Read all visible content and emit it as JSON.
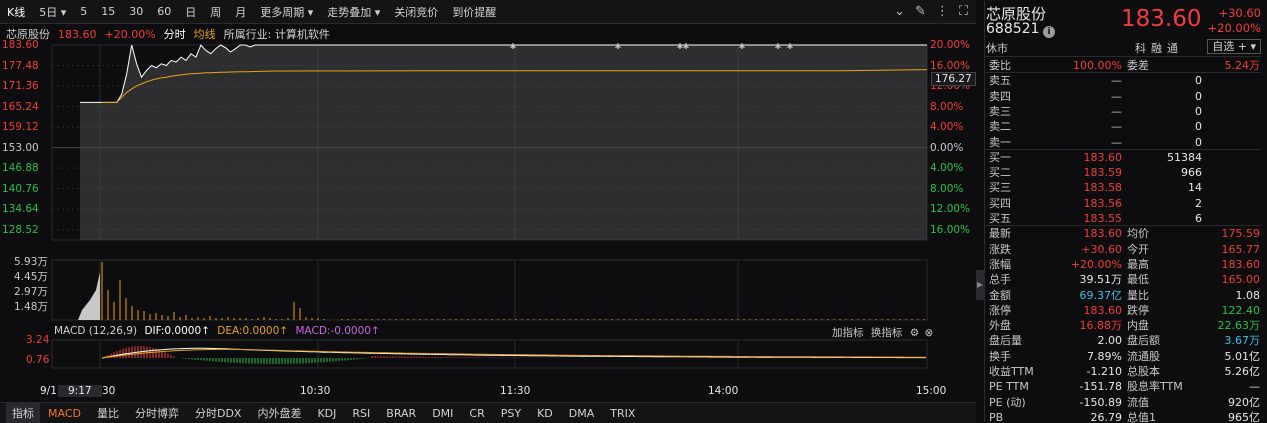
{
  "toolbar": {
    "items": [
      "K线",
      "5日",
      "5",
      "15",
      "30",
      "60",
      "日",
      "周",
      "月",
      "更多周期",
      "走势叠加",
      "关闭竞价",
      "到价提醒"
    ]
  },
  "chart_info": {
    "name": "芯原股份",
    "price": "183.60",
    "pct": "+20.00%",
    "fenshi": "分时",
    "junxian": "均线",
    "industry": "所属行业: 计算机软件"
  },
  "chart_data": {
    "type": "line",
    "price_ticks": [
      "183.60",
      "177.48",
      "171.36",
      "165.24",
      "159.12",
      "153.00",
      "146.88",
      "140.76",
      "134.64",
      "128.52"
    ],
    "pct_ticks": [
      "20.00%",
      "16.00%",
      "12.00%",
      "8.00%",
      "4.00%",
      "0.00%",
      "4.00%",
      "8.00%",
      "12.00%",
      "16.00%"
    ],
    "avg_label": "176.27",
    "vol_ticks": [
      "5.93万",
      "4.45万",
      "2.97万",
      "1.48万"
    ],
    "macd_ticks": [
      "3.24",
      "0.76"
    ],
    "macd_info": {
      "name": "MACD (12,26,9)",
      "dif": "DIF:0.0000",
      "dea": "DEA:0.0000",
      "macd": "MACD:-0.0000"
    },
    "macd_tools": [
      "加指标",
      "换指标"
    ],
    "time_labels": [
      "9/1",
      "9:17",
      "30",
      "10:30",
      "11:30",
      "14:00",
      "15:00"
    ],
    "ylim": [
      128.52,
      183.6
    ],
    "prev_close": 153.0,
    "price_series": [
      166.5,
      166.5,
      166.5,
      166.5,
      169,
      175,
      183.6,
      178,
      174,
      176,
      177.5,
      176.8,
      178,
      177.5,
      179,
      178.5,
      180,
      179,
      181,
      180,
      183.6,
      182,
      181,
      182.5,
      183.6,
      182.8,
      181.5,
      182.5,
      183.6,
      183.6,
      183,
      183.6,
      183.6,
      183.6,
      183.6,
      183.6
    ],
    "avg_series": [
      166.5,
      166.5,
      166.5,
      166.5,
      168,
      169.5,
      170.5,
      171.4,
      172,
      172.6,
      173.1,
      173.5,
      173.8,
      174,
      174.3,
      174.5,
      174.7,
      174.9,
      175.0,
      175.1,
      175.2,
      175.3,
      175.35,
      175.4,
      175.45,
      175.5,
      175.55,
      175.58,
      175.6,
      175.62,
      175.66,
      175.7,
      175.74,
      175.78,
      175.82,
      175.85
    ]
  },
  "panel": {
    "name": "芯原股份",
    "code": "688521",
    "price": "183.60",
    "change": "+30.60",
    "change_pct": "+20.00%",
    "status": "休市",
    "tags": [
      "科",
      "融",
      "通"
    ],
    "fav": "自选 +",
    "weibi": {
      "l1": "委比",
      "v1": "100.00%",
      "l2": "委差",
      "v2": "5.24万"
    },
    "sells": [
      {
        "label": "卖五",
        "price": "—",
        "vol": "0"
      },
      {
        "label": "卖四",
        "price": "—",
        "vol": "0"
      },
      {
        "label": "卖三",
        "price": "—",
        "vol": "0"
      },
      {
        "label": "卖二",
        "price": "—",
        "vol": "0"
      },
      {
        "label": "卖一",
        "price": "—",
        "vol": "0"
      }
    ],
    "buys": [
      {
        "label": "买一",
        "price": "183.60",
        "vol": "51384"
      },
      {
        "label": "买二",
        "price": "183.59",
        "vol": "966"
      },
      {
        "label": "买三",
        "price": "183.58",
        "vol": "14"
      },
      {
        "label": "买四",
        "price": "183.56",
        "vol": "2"
      },
      {
        "label": "买五",
        "price": "183.55",
        "vol": "6"
      }
    ],
    "stats": [
      {
        "l1": "最新",
        "v1": "183.60",
        "c1": "red",
        "l2": "均价",
        "v2": "175.59",
        "c2": "red"
      },
      {
        "l1": "涨跌",
        "v1": "+30.60",
        "c1": "red",
        "l2": "今开",
        "v2": "165.77",
        "c2": "red"
      },
      {
        "l1": "涨幅",
        "v1": "+20.00%",
        "c1": "red",
        "l2": "最高",
        "v2": "183.60",
        "c2": "red"
      },
      {
        "l1": "总手",
        "v1": "39.51万",
        "c1": "white",
        "l2": "最低",
        "v2": "165.00",
        "c2": "red"
      },
      {
        "l1": "金额",
        "v1": "69.37亿",
        "c1": "cyan",
        "l2": "量比",
        "v2": "1.08",
        "c2": "white"
      },
      {
        "l1": "涨停",
        "v1": "183.60",
        "c1": "red",
        "l2": "跌停",
        "v2": "122.40",
        "c2": "green"
      },
      {
        "l1": "外盘",
        "v1": "16.88万",
        "c1": "red",
        "l2": "内盘",
        "v2": "22.63万",
        "c2": "green"
      },
      {
        "l1": "盘后量",
        "v1": "2.00",
        "c1": "white",
        "l2": "盘后额",
        "v2": "3.67万",
        "c2": "cyan"
      },
      {
        "l1": "换手",
        "v1": "7.89%",
        "c1": "white",
        "l2": "流通股",
        "v2": "5.01亿",
        "c2": "white"
      },
      {
        "l1": "收益TTM",
        "v1": "-1.210",
        "c1": "white",
        "l2": "总股本",
        "v2": "5.26亿",
        "c2": "white"
      },
      {
        "l1": "PE TTM",
        "v1": "-151.78",
        "c1": "white",
        "l2": "股息率TTM",
        "v2": "—",
        "c2": "white"
      },
      {
        "l1": "PE (动)",
        "v1": "-150.89",
        "c1": "white",
        "l2": "流值",
        "v2": "920亿",
        "c2": "white"
      },
      {
        "l1": "PB",
        "v1": "26.79",
        "c1": "white",
        "l2": "总值1",
        "v2": "965亿",
        "c2": "white"
      }
    ]
  },
  "tabs": [
    "指标",
    "MACD",
    "量比",
    "分时博弈",
    "分时DDX",
    "内外盘差",
    "KDJ",
    "RSI",
    "BRAR",
    "DMI",
    "CR",
    "PSY",
    "KD",
    "DMA",
    "TRIX"
  ],
  "colors": {
    "up": "#f23b3b",
    "down": "#25c24a",
    "price_line": "#ffffff",
    "avg_line": "#e6a317",
    "macd_dif": "#ffffff",
    "macd_dea": "#e6a317"
  }
}
